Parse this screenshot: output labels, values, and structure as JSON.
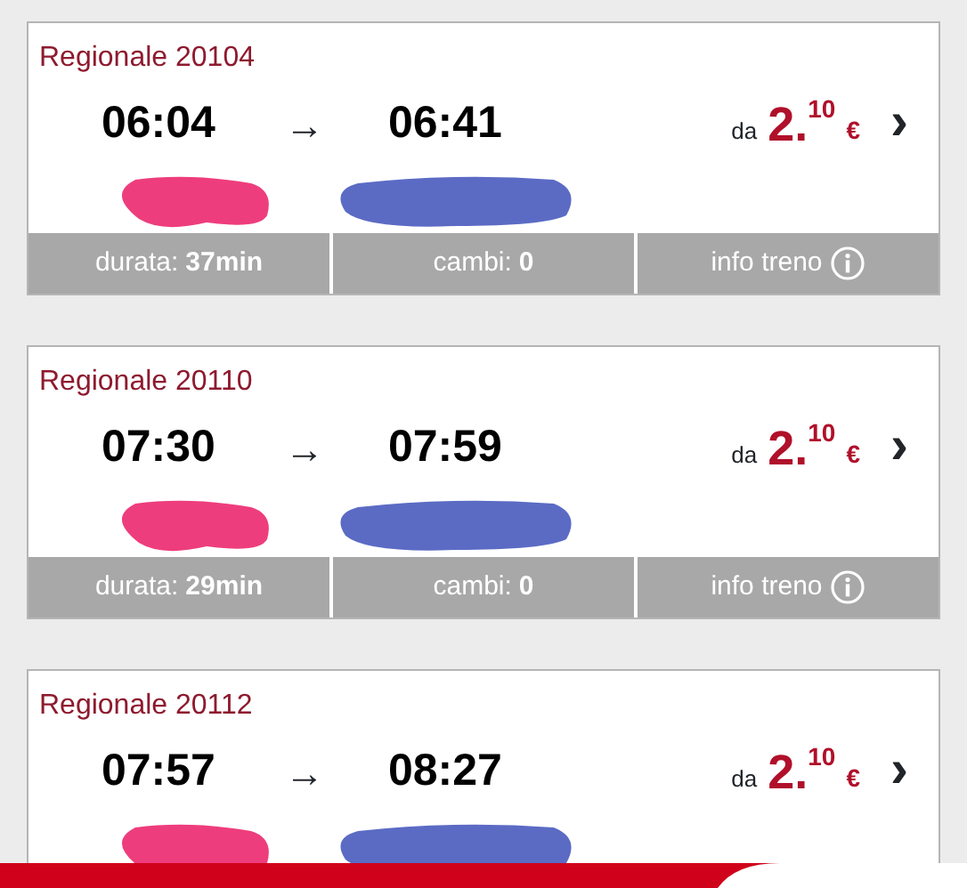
{
  "trains": [
    {
      "title": "Regionale 20104",
      "departure": "06:04",
      "arrow": "→",
      "arrival": "06:41",
      "price_prefix": "da",
      "price": "2.$^{10}$",
      "currency": "€",
      "chevron": "›",
      "footer": {
        "duration": "durata: **37min**",
        "changes": "cambi: **0**",
        "info": "info treno"
      }
    },
    {
      "title": "Regionale 20110",
      "departure": "07:30",
      "arrow": "→",
      "arrival": "07:59",
      "price_prefix": "da",
      "price": "2.$^{10}$",
      "currency": "€",
      "chevron": "›",
      "footer": {
        "duration": "durata: **29min**",
        "changes": "cambi: **0**",
        "info": "info treno"
      }
    },
    {
      "title": "Regionale 20112",
      "departure": "07:57",
      "arrow": "→",
      "arrival": "08:27",
      "price_prefix": "da",
      "price": "2.$^{10}$",
      "currency": "€",
      "chevron": "›"
    }
  ]
}
